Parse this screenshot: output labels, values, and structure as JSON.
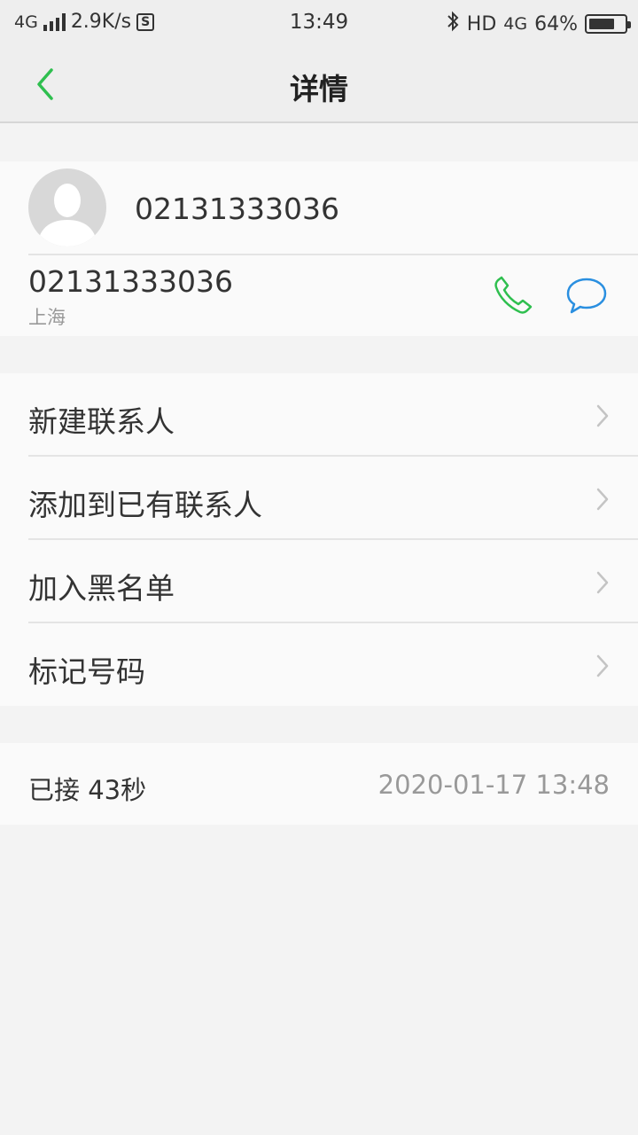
{
  "status_bar": {
    "network": "4G",
    "speed": "2.9K/s",
    "sim_icon": "S",
    "time": "13:49",
    "hd": "HD",
    "network_right": "4G",
    "battery_percent": "64%",
    "battery_level": 0.64
  },
  "header": {
    "title": "详情",
    "back_icon": "chevron-left-icon",
    "accent_color": "#2fbf4f"
  },
  "contact": {
    "name": "02131333036",
    "avatar_icon": "person-silhouette-icon",
    "number": "02131333036",
    "location": "上海",
    "call_icon": "phone-icon",
    "call_color": "#2fbf4f",
    "message_icon": "chat-bubble-icon",
    "message_color": "#2a8fe0"
  },
  "actions": [
    {
      "label": "新建联系人"
    },
    {
      "label": "添加到已有联系人"
    },
    {
      "label": "加入黑名单"
    },
    {
      "label": "标记号码"
    }
  ],
  "call_log": {
    "status": "已接 43秒",
    "datetime": "2020-01-17 13:48"
  }
}
